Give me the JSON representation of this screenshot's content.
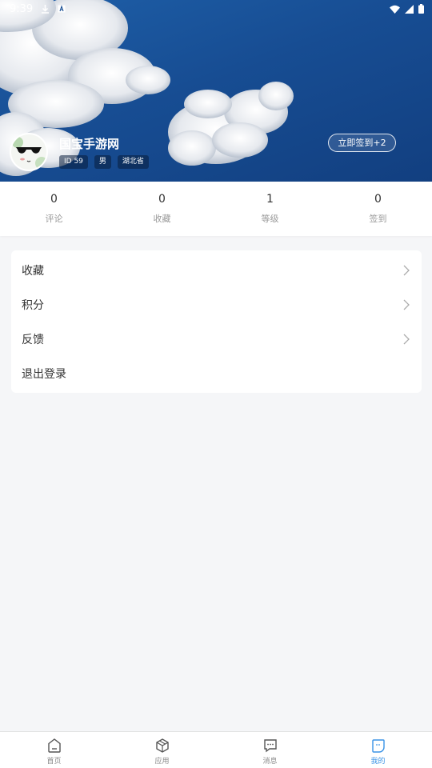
{
  "status_bar": {
    "time": "9:39",
    "icons": [
      "download-icon",
      "a-icon",
      "wifi-icon",
      "signal-icon",
      "battery-icon"
    ]
  },
  "profile": {
    "username": "国宝手游网",
    "tags": [
      "ID 59",
      "男",
      "湖北省"
    ],
    "checkin_label": "立即签到+2"
  },
  "stats": [
    {
      "value": "0",
      "label": "评论"
    },
    {
      "value": "0",
      "label": "收藏"
    },
    {
      "value": "1",
      "label": "等级"
    },
    {
      "value": "0",
      "label": "签到"
    }
  ],
  "menu": [
    {
      "label": "收藏",
      "chevron": true
    },
    {
      "label": "积分",
      "chevron": true
    },
    {
      "label": "反馈",
      "chevron": true
    },
    {
      "label": "退出登录",
      "chevron": false
    }
  ],
  "bottom_nav": [
    {
      "label": "首页",
      "icon": "home-icon",
      "active": false
    },
    {
      "label": "应用",
      "icon": "cube-icon",
      "active": false
    },
    {
      "label": "消息",
      "icon": "message-icon",
      "active": false
    },
    {
      "label": "我的",
      "icon": "profile-icon",
      "active": true
    }
  ],
  "colors": {
    "header_blue": "#174d93",
    "accent": "#3a93e6",
    "background": "#f5f6f8"
  }
}
